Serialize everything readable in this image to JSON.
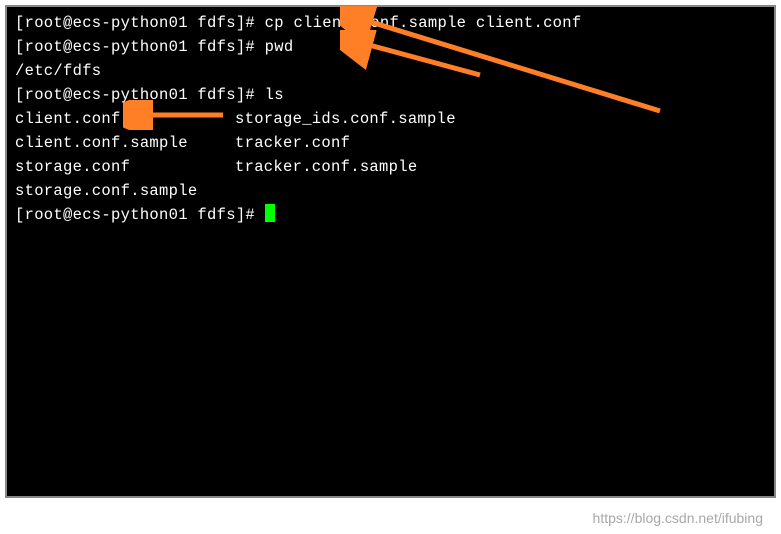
{
  "prompt": "[root@ecs-python01 fdfs]# ",
  "commands": {
    "cp": "cp client.conf.sample client.conf",
    "pwd": "pwd",
    "ls": "ls"
  },
  "output": {
    "pwd": "/etc/fdfs",
    "ls": {
      "col1": [
        "client.conf",
        "client.conf.sample",
        "storage.conf",
        "storage.conf.sample"
      ],
      "col2": [
        "storage_ids.conf.sample",
        "tracker.conf",
        "tracker.conf.sample"
      ]
    }
  },
  "watermark": "https://blog.csdn.net/ifubing"
}
